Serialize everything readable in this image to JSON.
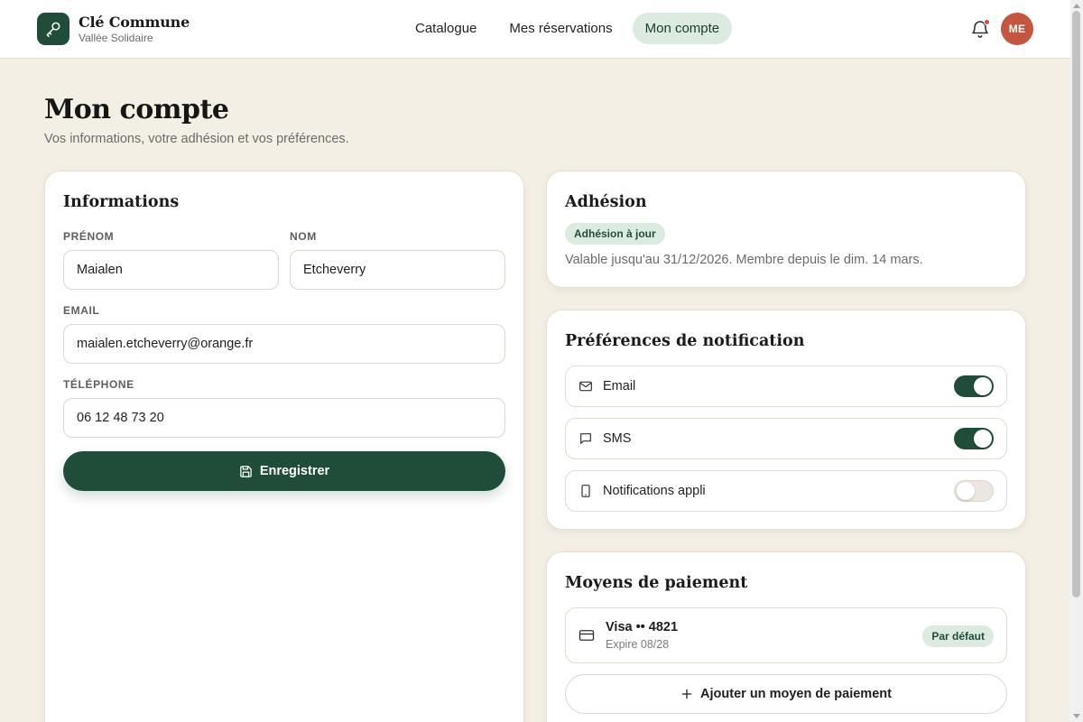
{
  "brand": {
    "name": "Clé Commune",
    "subtitle": "Vallée Solidaire",
    "icon": "key-icon"
  },
  "nav": {
    "items": [
      {
        "label": "Catalogue",
        "active": false
      },
      {
        "label": "Mes réservations",
        "active": false
      },
      {
        "label": "Mon compte",
        "active": true
      }
    ]
  },
  "header": {
    "notifications_icon": "bell-icon",
    "has_unread": true,
    "avatar_initials": "ME"
  },
  "page": {
    "title": "Mon compte",
    "subtitle": "Vos informations, votre adhésion et vos préférences."
  },
  "info": {
    "title": "Informations",
    "first_name_label": "PRÉNOM",
    "first_name_value": "Maialen",
    "last_name_label": "NOM",
    "last_name_value": "Etcheverry",
    "email_label": "EMAIL",
    "email_value": "maialen.etcheverry@orange.fr",
    "phone_label": "TÉLÉPHONE",
    "phone_value": "06 12 48 73 20",
    "save_label": "Enregistrer",
    "save_icon": "save-icon"
  },
  "membership": {
    "title": "Adhésion",
    "badge": "Adhésion à jour",
    "text": "Valable jusqu'au 31/12/2026. Membre depuis le dim. 14 mars."
  },
  "notifications": {
    "title": "Préférences de notification",
    "items": [
      {
        "label": "Email",
        "icon": "mail-icon",
        "enabled": true
      },
      {
        "label": "SMS",
        "icon": "message-icon",
        "enabled": true
      },
      {
        "label": "Notifications appli",
        "icon": "phone-icon",
        "enabled": false
      }
    ]
  },
  "payment": {
    "title": "Moyens de paiement",
    "cards": [
      {
        "name": "Visa •• 4821",
        "expiry": "Expire 08/28",
        "default_label": "Par défaut",
        "icon": "credit-card-icon"
      }
    ],
    "add_label": "Ajouter un moyen de paiement",
    "add_icon": "plus-icon"
  },
  "colors": {
    "primary": "#1f4d3a",
    "accent": "#c4553f",
    "background": "#f4efe4",
    "badge_bg": "#dcebe0"
  }
}
